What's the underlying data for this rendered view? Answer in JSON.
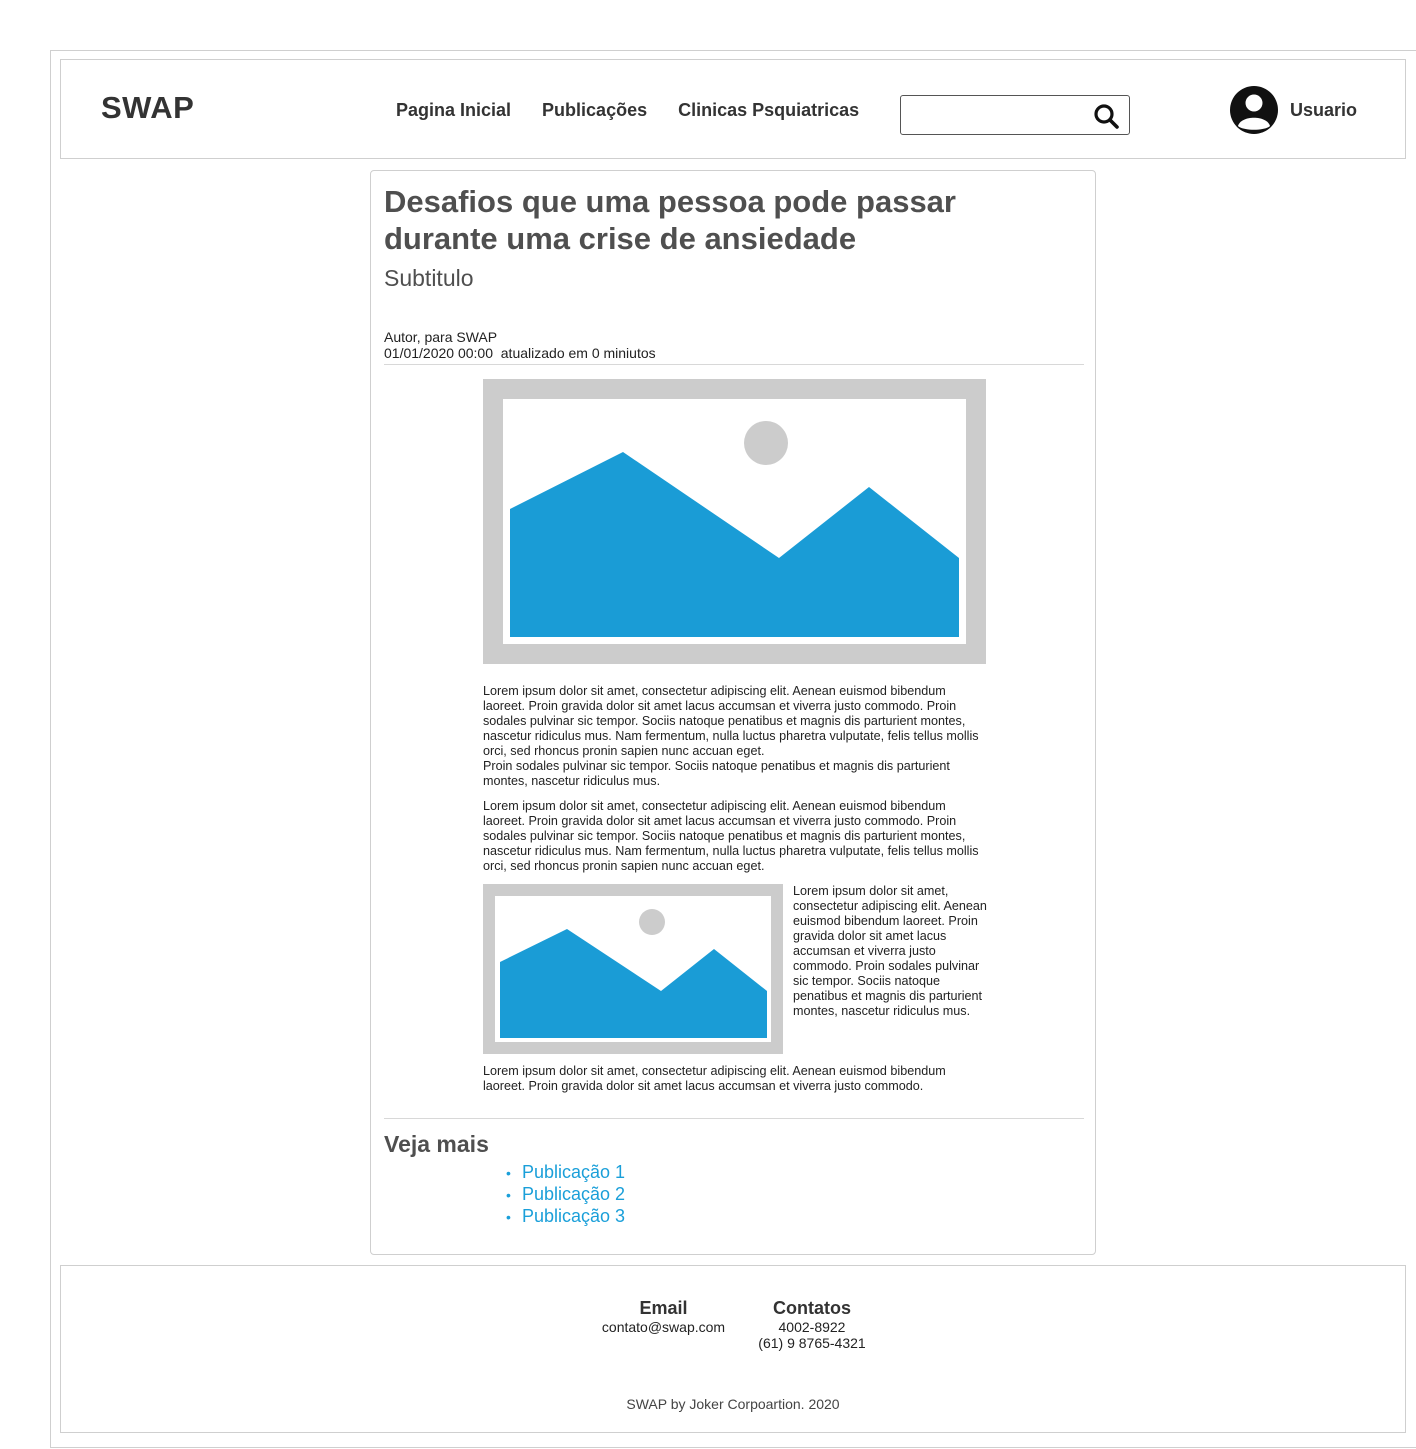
{
  "header": {
    "logo": "SWAP",
    "nav": [
      "Pagina Inicial",
      "Publicações",
      "Clinicas Psquiatricas"
    ],
    "search_placeholder": "",
    "user_label": "Usuario"
  },
  "article": {
    "title": "Desafios que uma pessoa pode passar durante uma crise de ansiedade",
    "subtitle": "Subtitulo",
    "author": "Autor, para SWAP",
    "date_line": "01/01/2020 00:00  atualizado em 0 miniutos",
    "paragraphs": [
      "Lorem ipsum dolor sit amet, consectetur adipiscing elit. Aenean euismod bibendum laoreet. Proin gravida dolor sit amet lacus accumsan et viverra justo commodo. Proin sodales pulvinar sic tempor. Sociis natoque penatibus et magnis dis parturient montes, nascetur ridiculus mus. Nam fermentum, nulla luctus pharetra vulputate, felis tellus mollis orci, sed rhoncus pronin sapien nunc accuan eget.",
      "Proin sodales pulvinar sic tempor. Sociis natoque penatibus et magnis dis parturient montes, nascetur ridiculus mus.",
      "Lorem ipsum dolor sit amet, consectetur adipiscing elit. Aenean euismod bibendum laoreet. Proin gravida dolor sit amet lacus accumsan et viverra justo commodo. Proin sodales pulvinar sic tempor. Sociis natoque penatibus et magnis dis parturient montes, nascetur ridiculus mus. Nam fermentum, nulla luctus pharetra vulputate, felis tellus mollis orci, sed rhoncus pronin sapien nunc accuan eget.",
      "Lorem ipsum dolor sit amet, consectetur adipiscing elit. Aenean euismod bibendum laoreet. Proin gravida dolor sit amet lacus accumsan et viverra justo commodo. Proin sodales pulvinar sic tempor. Sociis natoque penatibus et magnis dis parturient montes, nascetur ridiculus mus.",
      "Lorem ipsum dolor sit amet, consectetur adipiscing elit. Aenean euismod bibendum laoreet. Proin gravida dolor sit amet lacus accumsan et viverra justo commodo."
    ],
    "see_more_title": "Veja mais",
    "see_more_items": [
      "Publicação 1",
      "Publicação 2",
      "Publicação 3"
    ]
  },
  "footer": {
    "email_heading": "Email",
    "email_value": "contato@swap.com",
    "contacts_heading": "Contatos",
    "phone_1": "4002-8922",
    "phone_2": "(61) 9 8765-4321",
    "copyright": "SWAP by Joker Corpoartion. 2020"
  },
  "colors": {
    "link": "#1a9fd9",
    "image_placeholder_frame": "#cccccc",
    "image_placeholder_fill": "#1a9cd6"
  },
  "icons": [
    "search-icon",
    "user-avatar-icon",
    "image-placeholder-icon"
  ]
}
